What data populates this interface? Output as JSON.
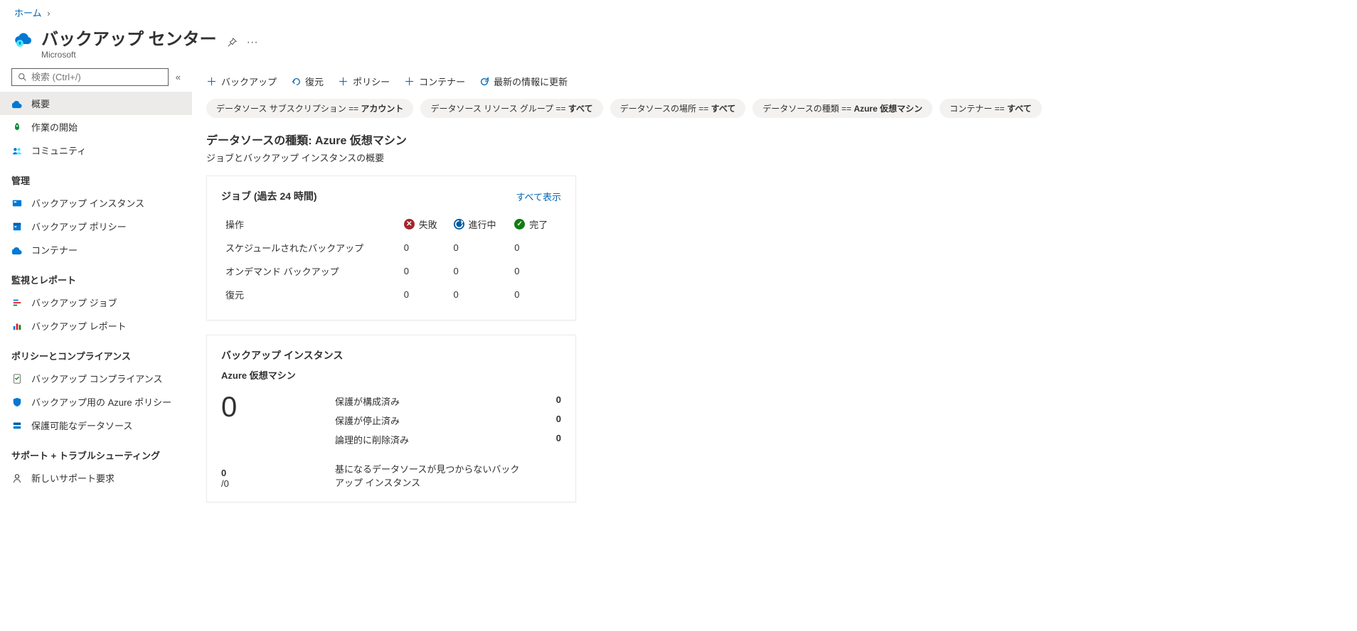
{
  "breadcrumb": {
    "home": "ホーム"
  },
  "header": {
    "title": "バックアップ センター",
    "subtitle": "Microsoft"
  },
  "search": {
    "placeholder": "検索 (Ctrl+/)"
  },
  "sidebar": {
    "items": [
      {
        "label": "概要"
      },
      {
        "label": "作業の開始"
      },
      {
        "label": "コミュニティ"
      }
    ],
    "sections": [
      {
        "label": "管理",
        "items": [
          {
            "label": "バックアップ インスタンス"
          },
          {
            "label": "バックアップ ポリシー"
          },
          {
            "label": "コンテナー"
          }
        ]
      },
      {
        "label": "監視とレポート",
        "items": [
          {
            "label": "バックアップ ジョブ"
          },
          {
            "label": "バックアップ レポート"
          }
        ]
      },
      {
        "label": "ポリシーとコンプライアンス",
        "items": [
          {
            "label": "バックアップ コンプライアンス"
          },
          {
            "label": "バックアップ用の Azure ポリシー"
          },
          {
            "label": "保護可能なデータソース"
          }
        ]
      },
      {
        "label": "サポート + トラブルシューティング",
        "items": [
          {
            "label": "新しいサポート要求"
          }
        ]
      }
    ]
  },
  "toolbar": {
    "backup": "バックアップ",
    "restore": "復元",
    "policy": "ポリシー",
    "vault": "コンテナー",
    "refresh": "最新の情報に更新"
  },
  "filters": [
    {
      "key": "データソース サブスクリプション == ",
      "value": "アカウント"
    },
    {
      "key": "データソース リソース グループ == ",
      "value": "すべて"
    },
    {
      "key": "データソースの場所 == ",
      "value": "すべて"
    },
    {
      "key": "データソースの種類 == ",
      "value": "Azure 仮想マシン"
    },
    {
      "key": "コンテナー == ",
      "value": "すべて"
    }
  ],
  "overview": {
    "heading": "データソースの種類: Azure 仮想マシン",
    "sub": "ジョブとバックアップ インスタンスの概要"
  },
  "jobs_card": {
    "title": "ジョブ (過去 24 時間)",
    "view_all": "すべて表示",
    "col_op": "操作",
    "col_fail": "失敗",
    "col_prog": "進行中",
    "col_done": "完了",
    "rows": [
      {
        "op": "スケジュールされたバックアップ",
        "fail": "0",
        "prog": "0",
        "done": "0"
      },
      {
        "op": "オンデマンド バックアップ",
        "fail": "0",
        "prog": "0",
        "done": "0"
      },
      {
        "op": "復元",
        "fail": "0",
        "prog": "0",
        "done": "0"
      }
    ]
  },
  "instances_card": {
    "title": "バックアップ インスタンス",
    "subtype": "Azure 仮想マシン",
    "total": "0",
    "stats": [
      {
        "label": "保護が構成済み",
        "value": "0"
      },
      {
        "label": "保護が停止済み",
        "value": "0"
      },
      {
        "label": "論理的に削除済み",
        "value": "0"
      }
    ],
    "frac_num": "0",
    "frac_den": "/0",
    "note": "基になるデータソースが見つからないバックアップ インスタンス"
  }
}
